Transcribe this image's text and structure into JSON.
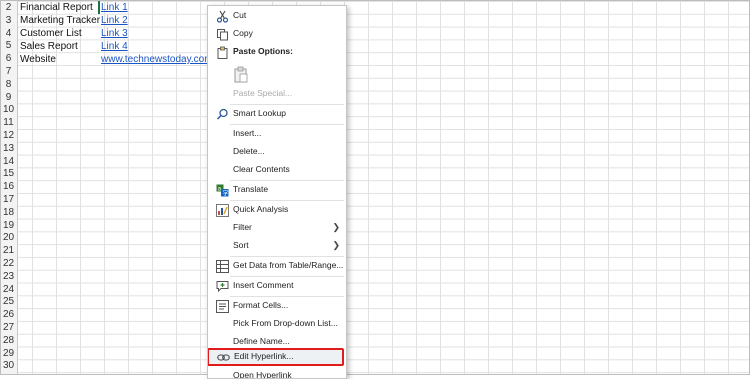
{
  "rows": [
    "2",
    "3",
    "4",
    "5",
    "6",
    "7",
    "8",
    "9",
    "10",
    "11",
    "12",
    "13",
    "14",
    "15",
    "16",
    "17",
    "18",
    "19",
    "20",
    "21",
    "22",
    "23",
    "24",
    "25",
    "26",
    "27",
    "28",
    "29",
    "30"
  ],
  "cells": {
    "a2": "Financial Report",
    "a3": "Marketing Tracker",
    "a4": "Customer List",
    "a5": "Sales Report",
    "a6": "Website",
    "b2": "Link 1",
    "b3": "Link 2",
    "b4": "Link 3",
    "b5": "Link 4",
    "b6": "www.technewstoday.com/"
  },
  "menu": {
    "cut": "Cut",
    "copy": "Copy",
    "paste_options": "Paste Options:",
    "paste_special": "Paste Special...",
    "smart_lookup": "Smart Lookup",
    "insert": "Insert...",
    "delete": "Delete...",
    "clear_contents": "Clear Contents",
    "translate": "Translate",
    "quick_analysis": "Quick Analysis",
    "filter": "Filter",
    "sort": "Sort",
    "get_data": "Get Data from Table/Range...",
    "insert_comment": "Insert Comment",
    "format_cells": "Format Cells...",
    "pick_from_list": "Pick From Drop-down List...",
    "define_name": "Define Name...",
    "edit_hyperlink": "Edit Hyperlink...",
    "open_hyperlink": "Open Hyperlink"
  },
  "icons": {
    "cut": "scissors-icon",
    "copy": "copy-icon",
    "paste": "clipboard-icon",
    "smart_lookup": "search-icon",
    "translate": "translate-icon",
    "quick_analysis": "quick-analysis-icon",
    "get_data": "table-icon",
    "insert_comment": "comment-icon",
    "format_cells": "format-cells-icon",
    "edit_hyperlink": "link-icon"
  },
  "colors": {
    "link": "#1a55c4",
    "highlight_border": "#e11b1b",
    "accent": "#2b579a"
  }
}
